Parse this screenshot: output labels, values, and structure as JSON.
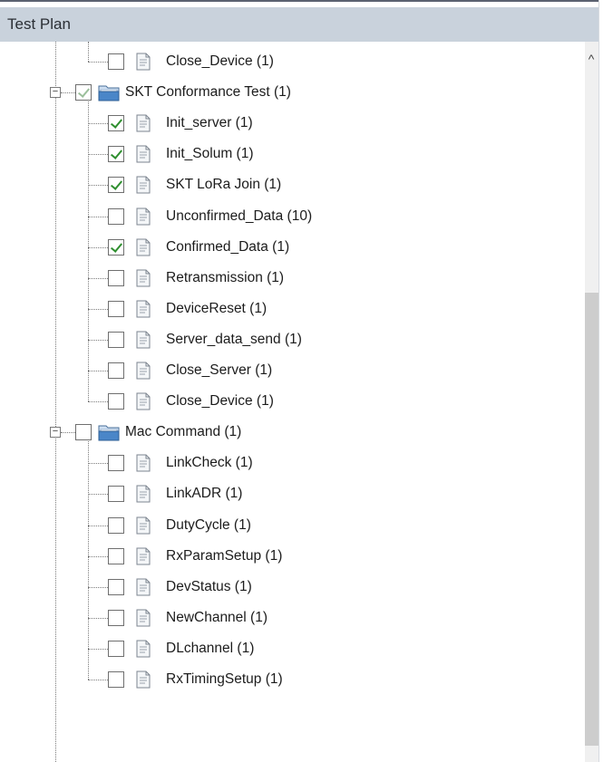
{
  "panel": {
    "title": "Test Plan"
  },
  "tree": {
    "items": [
      {
        "label": "Close_Device (1)",
        "type": "doc",
        "level": 2,
        "checked": false
      },
      {
        "label": "SKT Conformance Test (1)",
        "type": "folder",
        "level": 1,
        "checked": "partial"
      },
      {
        "label": "Init_server (1)",
        "type": "doc",
        "level": 2,
        "checked": true
      },
      {
        "label": "Init_Solum (1)",
        "type": "doc",
        "level": 2,
        "checked": true
      },
      {
        "label": "SKT LoRa Join (1)",
        "type": "doc",
        "level": 2,
        "checked": true
      },
      {
        "label": "Unconfirmed_Data (10)",
        "type": "doc",
        "level": 2,
        "checked": false
      },
      {
        "label": "Confirmed_Data (1)",
        "type": "doc",
        "level": 2,
        "checked": true
      },
      {
        "label": "Retransmission (1)",
        "type": "doc",
        "level": 2,
        "checked": false
      },
      {
        "label": "DeviceReset (1)",
        "type": "doc",
        "level": 2,
        "checked": false
      },
      {
        "label": "Server_data_send (1)",
        "type": "doc",
        "level": 2,
        "checked": false
      },
      {
        "label": "Close_Server (1)",
        "type": "doc",
        "level": 2,
        "checked": false
      },
      {
        "label": "Close_Device (1)",
        "type": "doc",
        "level": 2,
        "checked": false
      },
      {
        "label": "Mac Command (1)",
        "type": "folder",
        "level": 1,
        "checked": false
      },
      {
        "label": "LinkCheck (1)",
        "type": "doc",
        "level": 2,
        "checked": false
      },
      {
        "label": "LinkADR (1)",
        "type": "doc",
        "level": 2,
        "checked": false
      },
      {
        "label": "DutyCycle (1)",
        "type": "doc",
        "level": 2,
        "checked": false
      },
      {
        "label": "RxParamSetup (1)",
        "type": "doc",
        "level": 2,
        "checked": false
      },
      {
        "label": "DevStatus (1)",
        "type": "doc",
        "level": 2,
        "checked": false
      },
      {
        "label": "NewChannel (1)",
        "type": "doc",
        "level": 2,
        "checked": false
      },
      {
        "label": "DLchannel (1)",
        "type": "doc",
        "level": 2,
        "checked": false
      },
      {
        "label": "RxTimingSetup (1)",
        "type": "doc",
        "level": 2,
        "checked": false
      }
    ]
  },
  "expander_symbol": "−",
  "scrollbar": {
    "up_arrow": "^"
  },
  "colors": {
    "header_bg": "#c9d2dc",
    "check_green": "#2f8f2f",
    "folder_blue": "#4a86c8"
  },
  "icons": {
    "doc": "document-icon",
    "folder": "folder-icon",
    "expander": "collapse-icon"
  }
}
